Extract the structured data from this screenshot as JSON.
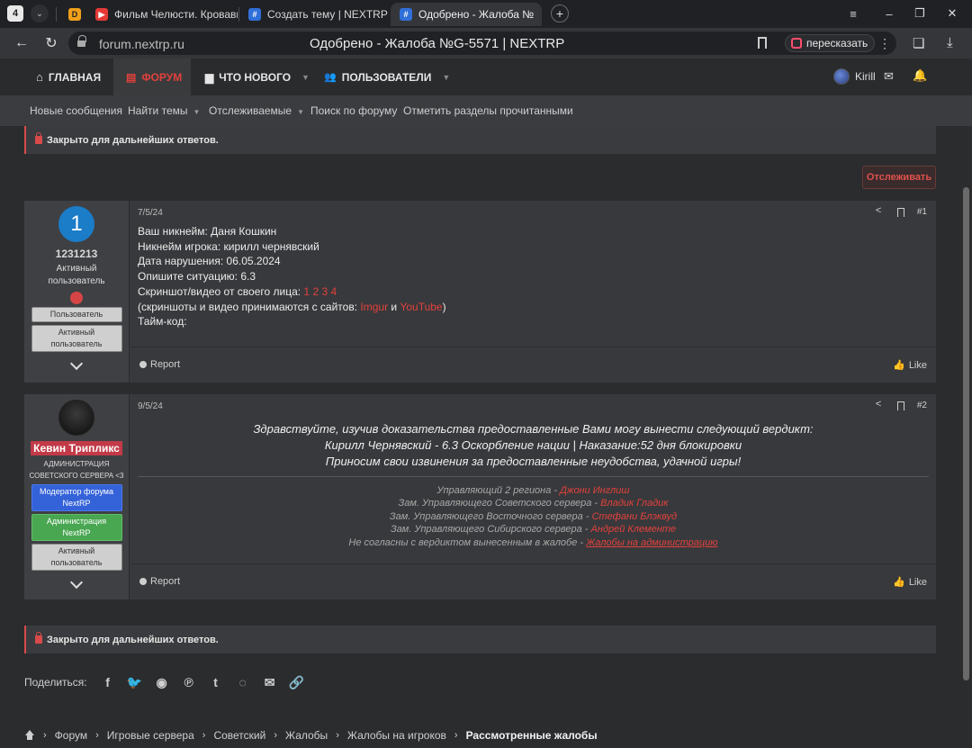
{
  "browser": {
    "tab_count": "4",
    "tabs": [
      {
        "label": "Фильм Челюсти. Кровавь",
        "fav_color": "#e53935"
      },
      {
        "label": "Создать тему | NEXTRP",
        "fav_color": "#2f6fd8"
      },
      {
        "label": "Одобрено - Жалоба №",
        "fav_color": "#2f6fd8"
      }
    ],
    "url_host": "forum.nextrp.ru",
    "page_title": "Одобрено - Жалоба №G-5571 | NEXTRP",
    "retell_label": "пересказать"
  },
  "nav": {
    "home": "ГЛАВНАЯ",
    "forum": "ФОРУМ",
    "whats_new": "ЧТО НОВОГО",
    "users": "ПОЛЬЗОВАТЕЛИ",
    "username": "Kirill"
  },
  "subnav": [
    "Новые сообщения",
    "Найти темы",
    "Отслеживаемые",
    "Поиск по форуму",
    "Отметить разделы прочитанными"
  ],
  "notice_text": "Закрыто для дальнейших ответов.",
  "watch_label": "Отслеживать",
  "post1": {
    "avatar_letter": "1",
    "username": "1231213",
    "title_line1": "Активный",
    "title_line2": "пользователь",
    "banner1": "Пользователь",
    "banner2_line1": "Активный",
    "banner2_line2": "пользователь",
    "date": "7/5/24",
    "number": "#1",
    "lines": [
      "Ваш никнейм: Даня Кошкин",
      "Никнейм игрока: кирилл чернявский",
      "Дата нарушения: 06.05.2024",
      "Опишите ситуацию: 6.3"
    ],
    "proof_prefix": "Скриншот/видео от своего лица: ",
    "proof_links": [
      "1",
      "2",
      "3",
      "4"
    ],
    "sites_prefix": "(скриншоты и видео принимаются с сайтов: ",
    "site1": "Imgur",
    "sites_and": " и ",
    "site2": "YouTube",
    "sites_suffix": ")",
    "timecode": "Тайм-код:",
    "report": "Report",
    "like": "Like"
  },
  "post2": {
    "username": "Кевин Трипликс",
    "title_line1": "АДМИНИСТРАЦИЯ",
    "title_line2": "СОВЕТСКОГО СЕРВЕРА <3",
    "banner1_line1": "Модератор форума",
    "banner1_line2": "NextRP",
    "banner2_line1": "Администрация",
    "banner2_line2": "NextRP",
    "banner3_line1": "Активный",
    "banner3_line2": "пользователь",
    "date": "9/5/24",
    "number": "#2",
    "verdict": [
      "Здравствуйте, изучив доказательства предоставленные Вами могу вынести следующий вердикт:",
      "Кирилл Чернявский - 6.3 Оскорбление нации | Наказание:52 дня блокировки",
      "Приносим свои извинения за предоставленные неудобства, удачной игры!"
    ],
    "staff": [
      {
        "role": "Управляющий 2 региона - ",
        "name": "Джони Инглиш"
      },
      {
        "role": "Зам. Управляющего Советского сервера - ",
        "name": "Владик Гладик"
      },
      {
        "role": "Зам. Управляющего Восточного сервера - ",
        "name": "Стефани Блэквуд"
      },
      {
        "role": "Зам. Управляющего Сибирского сервера - ",
        "name": "Андрей Клементе"
      },
      {
        "role": "Не согласны с вердиктом вынесенным в жалобе - ",
        "name": "Жалобы на администрацию"
      }
    ],
    "report": "Report",
    "like": "Like"
  },
  "share_label": "Поделиться:",
  "share_icons": [
    "facebook-icon",
    "twitter-icon",
    "reddit-icon",
    "pinterest-icon",
    "tumblr-icon",
    "whatsapp-icon",
    "email-icon",
    "link-icon"
  ],
  "breadcrumbs": [
    "Форум",
    "Игровые сервера",
    "Советский",
    "Жалобы",
    "Жалобы на игроков",
    "Рассмотренные жалобы"
  ],
  "colors": {
    "accent": "#e2413c",
    "background": "#2b2c2e",
    "panel": "#38393c"
  }
}
